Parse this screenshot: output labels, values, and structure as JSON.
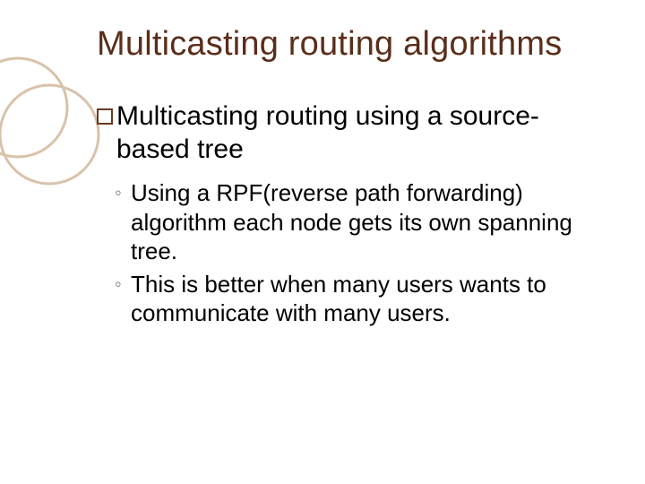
{
  "slide": {
    "title": "Multicasting routing algorithms",
    "main_bullet": "Multicasting routing using a source-based tree",
    "sub_bullets": [
      "Using a RPF(reverse path forwarding) algorithm each node gets its own spanning tree.",
      "This is better when many users wants to communicate with many users."
    ]
  },
  "colors": {
    "title": "#5a2e1a",
    "circle_stroke": "#c9a98a",
    "bullet_border": "#6b3a20"
  }
}
